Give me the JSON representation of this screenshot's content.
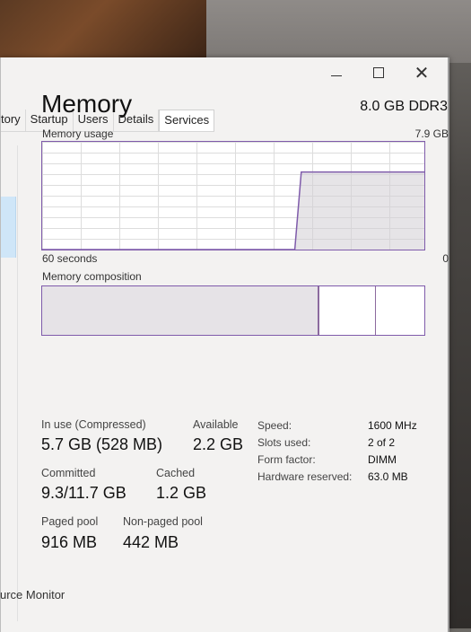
{
  "window": {
    "close_glyph": "✕"
  },
  "tabs": [
    "tory",
    "Startup",
    "Users",
    "Details",
    "Services"
  ],
  "memory": {
    "title": "Memory",
    "spec": "8.0 GB DDR3",
    "usage_label": "Memory usage",
    "usage_max": "7.9 GB",
    "time_left": "60 seconds",
    "time_right": "0",
    "composition_label": "Memory composition",
    "usage_history_fraction": [
      0,
      0,
      0,
      0,
      0,
      0,
      0,
      0,
      0,
      0,
      0,
      0,
      0,
      0,
      0,
      0,
      0,
      0,
      0,
      0,
      0,
      0,
      0,
      0,
      0,
      0,
      0,
      0,
      0,
      0,
      0,
      0,
      0,
      0,
      0,
      0,
      0,
      0,
      0,
      0,
      0.72,
      0.72,
      0.72,
      0.72,
      0.72,
      0.72,
      0.72,
      0.72,
      0.72,
      0.72,
      0.72,
      0.72,
      0.72,
      0.72,
      0.72,
      0.72,
      0.72,
      0.72,
      0.72,
      0.72
    ],
    "composition_fractions": {
      "in_use": 0.72,
      "modified": 0.15,
      "free": 0.13
    }
  },
  "stats": {
    "in_use_label": "In use (Compressed)",
    "in_use_value": "5.7 GB (528 MB)",
    "available_label": "Available",
    "available_value": "2.2 GB",
    "committed_label": "Committed",
    "committed_value": "9.3/11.7 GB",
    "cached_label": "Cached",
    "cached_value": "1.2 GB",
    "paged_label": "Paged pool",
    "paged_value": "916 MB",
    "nonpaged_label": "Non-paged pool",
    "nonpaged_value": "442 MB"
  },
  "properties": [
    {
      "label": "Speed:",
      "value": "1600 MHz"
    },
    {
      "label": "Slots used:",
      "value": "2 of 2"
    },
    {
      "label": "Form factor:",
      "value": "DIMM"
    },
    {
      "label": "Hardware reserved:",
      "value": "63.0 MB"
    }
  ],
  "footer_link": "urce Monitor"
}
